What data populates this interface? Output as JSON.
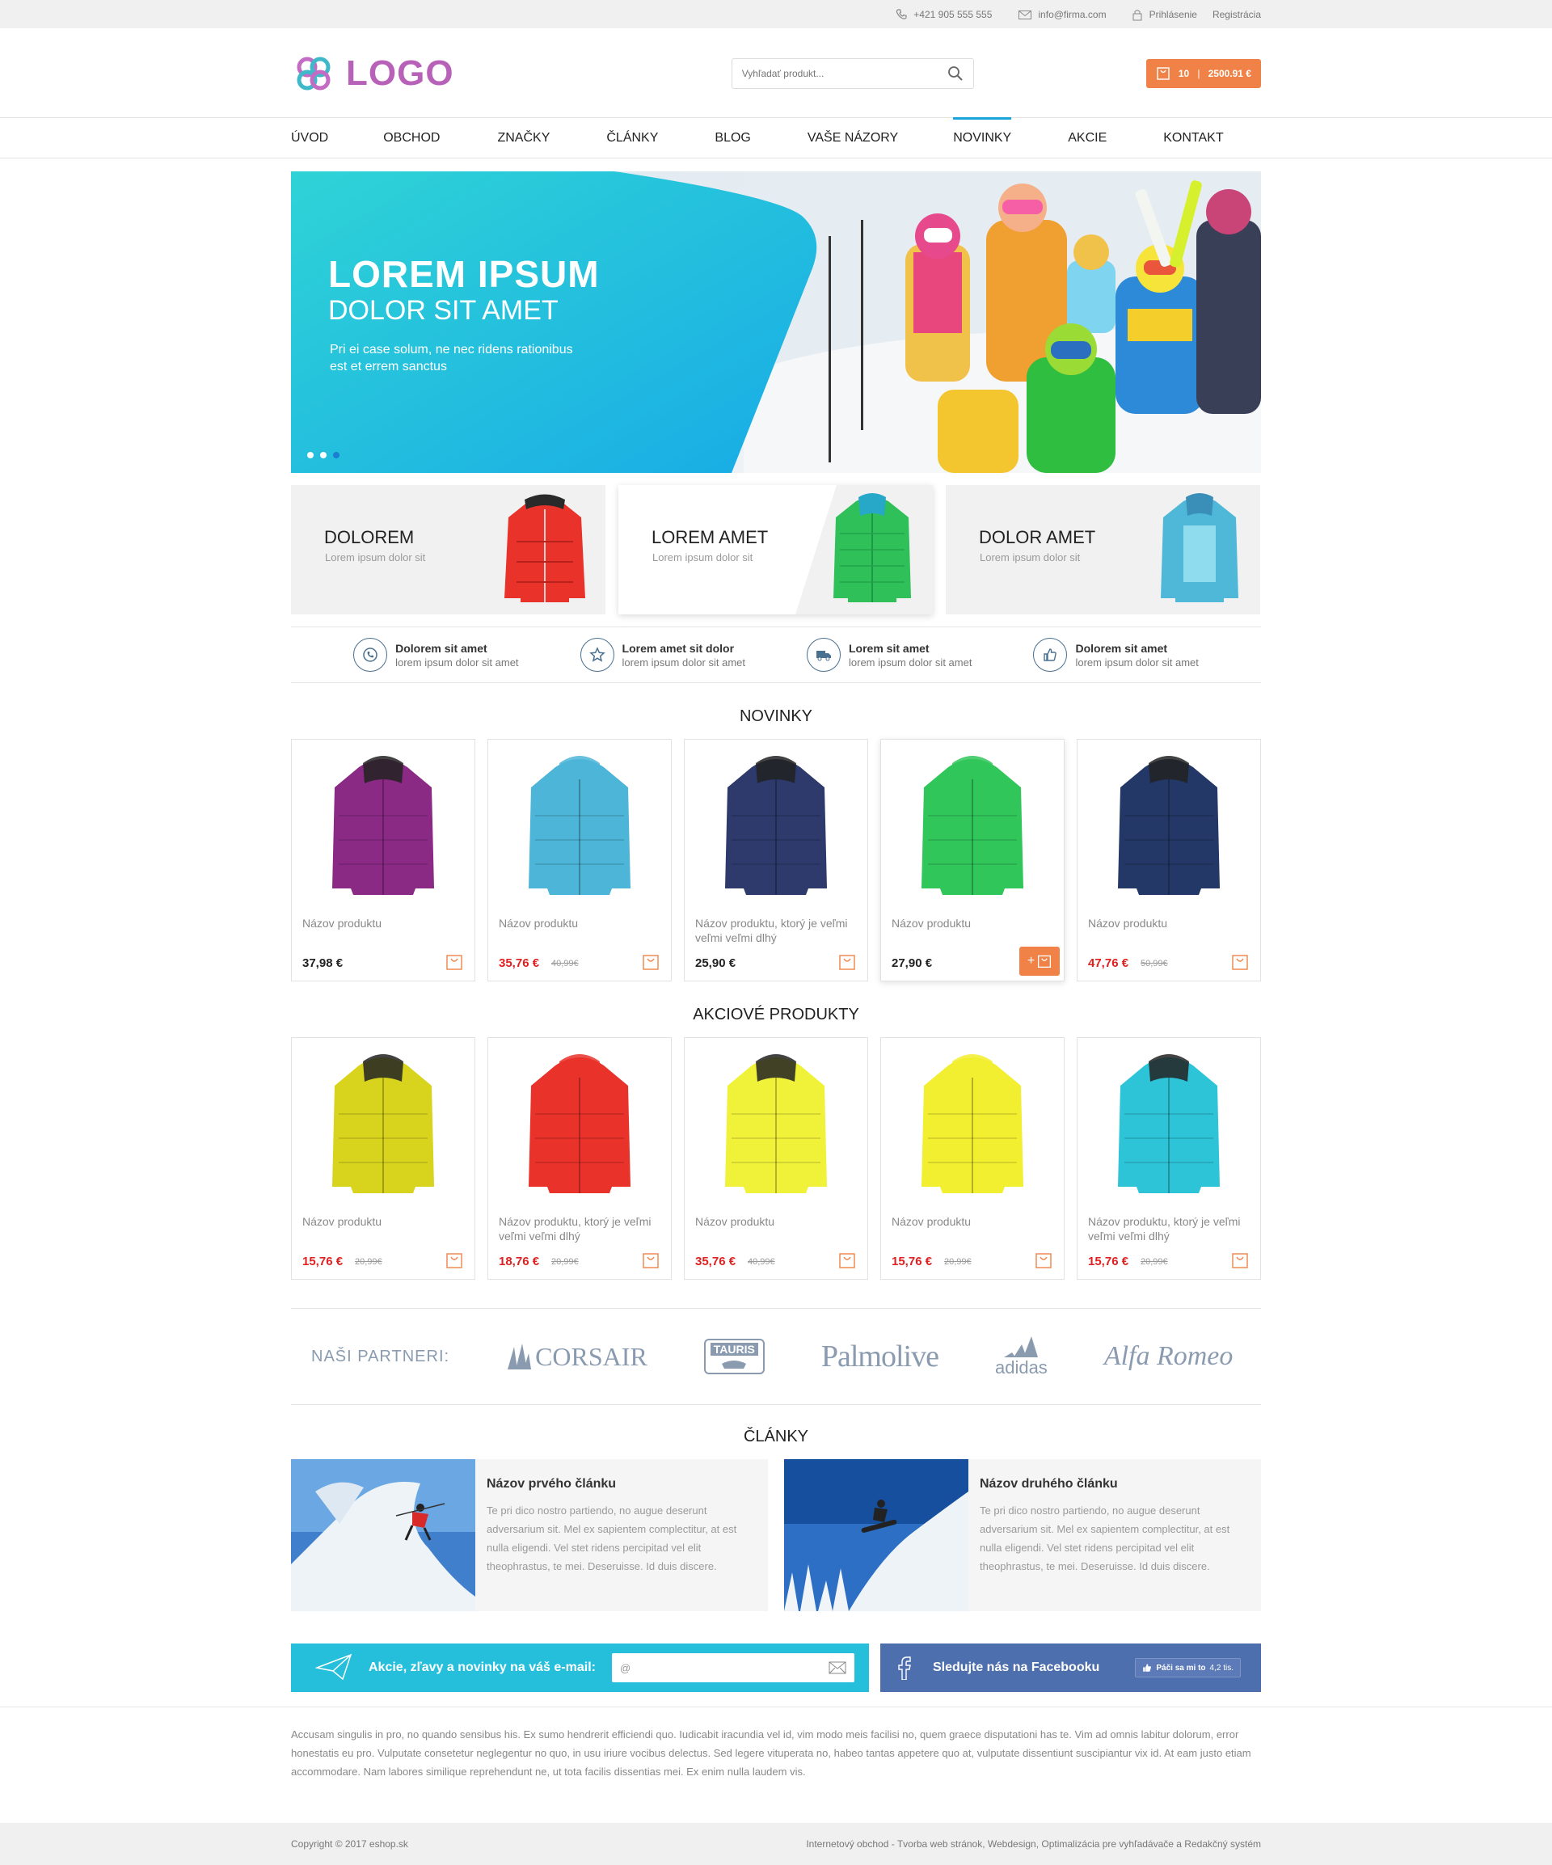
{
  "topbar": {
    "phone": "+421 905 555 555",
    "email": "info@firma.com",
    "login": "Prihlásenie",
    "register": "Registrácia"
  },
  "header": {
    "logo": "LOGO",
    "search_placeholder": "Vyhľadať produkt...",
    "cart_count": "10",
    "cart_total": "2500.91 €"
  },
  "nav": [
    "ÚVOD",
    "OBCHOD",
    "ZNAČKY",
    "ČLÁNKY",
    "BLOG",
    "VAŠE NÁZORY",
    "NOVINKY",
    "AKCIE",
    "KONTAKT"
  ],
  "hero": {
    "title": "LOREM IPSUM",
    "subtitle": "DOLOR SIT AMET",
    "text_1": "Pri ei case solum, ne nec ridens rationibus",
    "text_2": "est et errem sanctus"
  },
  "categories": [
    {
      "title": "DOLOREM",
      "sub": "Lorem ipsum dolor sit",
      "color": "#e8322a"
    },
    {
      "title": "LOREM AMET",
      "sub": "Lorem ipsum dolor sit",
      "color": "#2fc05a"
    },
    {
      "title": "DOLOR AMET",
      "sub": "Lorem ipsum dolor sit",
      "color": "#4fb7d8"
    }
  ],
  "features": [
    {
      "title": "Dolorem sit amet",
      "sub": "lorem ipsum dolor sit amet",
      "icon": "phone-icon"
    },
    {
      "title": "Lorem amet sit dolor",
      "sub": "lorem ipsum dolor sit amet",
      "icon": "star-icon"
    },
    {
      "title": "Lorem sit amet",
      "sub": "lorem ipsum dolor sit amet",
      "icon": "truck-icon"
    },
    {
      "title": "Dolorem sit amet",
      "sub": "lorem ipsum dolor sit amet",
      "icon": "thumbs-up-icon"
    }
  ],
  "novinky": {
    "title": "NOVINKY",
    "products": [
      {
        "name": "Názov produktu",
        "price": "37,98 €",
        "old": "",
        "color": "#8a2a85"
      },
      {
        "name": "Názov produktu",
        "price": "35,76 €",
        "old": "40,99€",
        "color": "#4cb5d8"
      },
      {
        "name": "Názov produktu, ktorý je veľmi veľmi veľmi dlhý",
        "price": "25,90 €",
        "old": "",
        "color": "#2d3a6b"
      },
      {
        "name": "Názov produktu",
        "price": "27,90 €",
        "old": "",
        "color": "#30c65a"
      },
      {
        "name": "Názov produktu",
        "price": "47,76 €",
        "old": "50,99€",
        "color": "#233866"
      }
    ]
  },
  "akciove": {
    "title": "AKCIOVÉ PRODUKTY",
    "products": [
      {
        "name": "Názov produktu",
        "price": "15,76 €",
        "old": "20,99€",
        "color": "#d8d41e"
      },
      {
        "name": "Názov produktu, ktorý je veľmi veľmi veľmi dlhý",
        "price": "18,76 €",
        "old": "20,99€",
        "color": "#e8322a"
      },
      {
        "name": "Názov produktu",
        "price": "35,76 €",
        "old": "40,99€",
        "color": "#f0f23a"
      },
      {
        "name": "Názov produktu",
        "price": "15,76 €",
        "old": "20,99€",
        "color": "#f2ee30"
      },
      {
        "name": "Názov produktu, ktorý je veľmi veľmi veľmi dlhý",
        "price": "15,76 €",
        "old": "20,99€",
        "color": "#2ec4d8"
      }
    ]
  },
  "partners": {
    "label": "NAŠI PARTNERI:",
    "brands": [
      "CORSAIR",
      "TAURIS",
      "Palmolive",
      "adidas",
      "Alfa Romeo"
    ]
  },
  "articles": {
    "title": "ČLÁNKY",
    "items": [
      {
        "title": "Názov prvého článku",
        "text": "Te pri dico nostro partiendo, no augue deserunt adversarium sit. Mel ex sapientem complectitur, at est nulla eligendi. Vel stet ridens percipitad vel elit theophrastus, te mei. Deseruisse. Id duis discere."
      },
      {
        "title": "Názov druhého článku",
        "text": "Te pri dico nostro partiendo, no augue deserunt adversarium sit. Mel ex sapientem complectitur, at est nulla eligendi. Vel stet ridens percipitad vel elit theophrastus, te mei. Deseruisse. Id duis discere."
      }
    ]
  },
  "newsletter": {
    "label": "Akcie, zľavy a novinky na váš e-mail:",
    "placeholder": "@"
  },
  "facebook": {
    "label": "Sledujte nás na Facebooku",
    "like": "Páči sa mi to",
    "count": "4,2 tis."
  },
  "footer": {
    "text": "Accusam singulis in pro, no quando sensibus his. Ex sumo hendrerit efficiendi quo. Iudicabit iracundia vel id, vim modo meis facilisi no, quem graece disputationi has te. Vim ad omnis labitur dolorum, error honestatis eu pro. Vulputate consetetur neglegentur no quo, in usu iriure vocibus delectus. Sed legere vituperata no, habeo tantas appetere quo at, vulputate dissentiunt suscipiantur vix id. At eam justo etiam accommodare. Nam labores similique reprehendunt ne, ut tota facilis dissentias mei. Ex enim nulla laudem vis.",
    "copyright": "Copyright © 2017 eshop.sk",
    "credits": "Internetový obchod - Tvorba web stránok, Webdesign, Optimalizácia pre vyhľadávače a Redakčný systém"
  },
  "colors": {
    "accent": "#1aa3dd",
    "cart": "#f08247",
    "sale": "#e02020",
    "brand": "#b861b8"
  }
}
